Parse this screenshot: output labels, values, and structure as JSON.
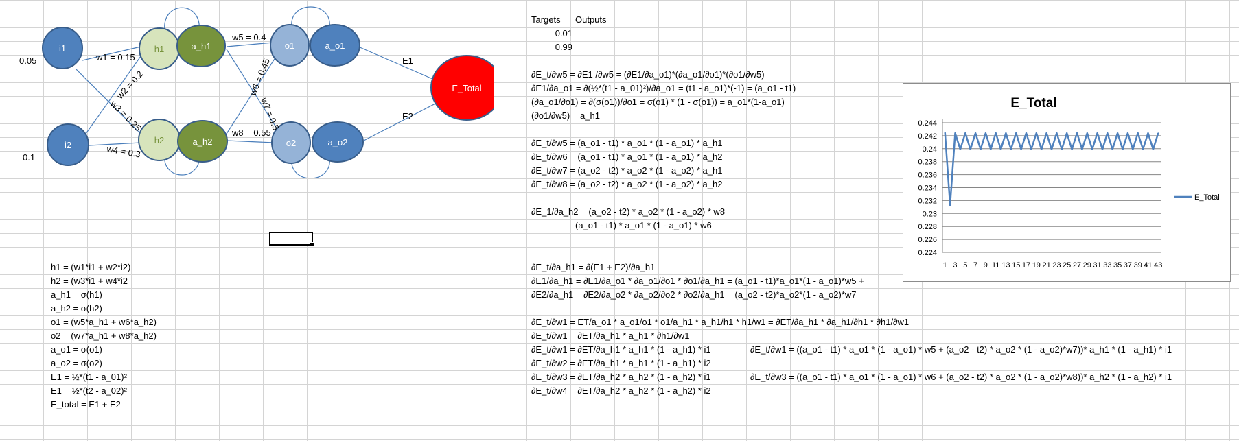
{
  "network": {
    "nodes": {
      "i1": "i1",
      "i2": "i2",
      "h1": "h1",
      "a_h1": "a_h1",
      "h2": "h2",
      "a_h2": "a_h2",
      "o1": "o1",
      "a_o1": "a_o1",
      "o2": "o2",
      "a_o2": "a_o2",
      "e_total": "E_Total"
    },
    "inputs": {
      "i1": "0.05",
      "i2": "0.1"
    },
    "weights": {
      "w1": "w1 = 0.15",
      "w2": "w2 = 0.2",
      "w3": "w3 = 0.25",
      "w4": "w4 = 0.3",
      "w5": "w5 = 0.4",
      "w6": "w6 = 0.45",
      "w7": "w7 = 0.5",
      "w8": "w8 = 0.55"
    },
    "errors": {
      "e1": "E1",
      "e2": "E2"
    },
    "colors": {
      "input_fill": "#4f81bd",
      "hidden_fill": "#d7e4bc",
      "hidden_text": "#77933c",
      "activation_fill": "#77933c",
      "output_fill": "#95b3d7",
      "output_act_fill": "#4f81bd",
      "total_fill": "#ff0000",
      "stroke": "#385d8a",
      "edge": "#4a7ebb"
    }
  },
  "targets": {
    "header_targets": "Targets",
    "header_outputs": "Outputs",
    "values": [
      "0.01",
      "0.99"
    ]
  },
  "forward_equations": [
    "h1 = (w1*i1 + w2*i2)",
    " h2 = (w3*i1 + w4*i2",
    "a_h1 = σ(h1)",
    "a_h2 = σ(h2)",
    "o1 = (w5*a_h1 + w6*a_h2)",
    "o2 = (w7*a_h1 + w8*a_h2)",
    "a_o1 = σ(o1)",
    "a_o2 = σ(o2)",
    "E1 = ½*(t1 - a_01)²",
    "E1 = ½*(t2 - a_02)²",
    "E_total = E1 + E2"
  ],
  "derivatives_w5": [
    "∂E_t/∂w5 = ∂E1 /∂w5 = (∂E1/∂a_o1)*(∂a_o1/∂o1)*(∂o1/∂w5)",
    "∂E1/∂a_o1 = ∂(½*(t1 - a_01)²)/∂a_o1 = (t1 - a_o1)*(-1) = (a_o1 - t1)",
    "(∂a_o1/∂o1) = ∂(σ(o1))/∂o1 = σ(o1) * (1 - σ(o1)) = a_o1*(1-a_o1)",
    "(∂o1/∂w5) = a_h1"
  ],
  "derivatives_w5_w8": [
    "∂E_t/∂w5 = (a_o1 - t1) * a_o1 * (1 - a_o1) * a_h1",
    "∂E_t/∂w6 = (a_o1 - t1) * a_o1 * (1 - a_o1) * a_h2",
    "∂E_t/∂w7 = (a_o2 - t2) * a_o2 * (1 - a_o2) * a_h1",
    "∂E_t/∂w8 = (a_o2 - t2) * a_o2 * (1 - a_o2) * a_h2"
  ],
  "derivative_a_h2": [
    "∂E_1/∂a_h2 = (a_o2 - t2) * a_o2 * (1 - a_o2) * w8",
    "(a_o1 - t1) * a_o1 * (1 - a_o1) * w6"
  ],
  "derivative_a_h1": [
    "∂E_t/∂a_h1 = ∂(E1 + E2)/∂a_h1",
    "∂E1/∂a_h1 = ∂E1/∂a_o1 * ∂a_o1/∂o1 * ∂o1/∂a_h1 = (a_o1 - t1)*a_o1*(1 - a_o1)*w5 +",
    "∂E2/∂a_h1 = ∂E2/∂a_o2 * ∂a_o2/∂o2 * ∂o2/∂a_h1 = (a_o2 - t2)*a_o2*(1 - a_o2)*w7"
  ],
  "derivatives_w1_w4": [
    "∂E_t/∂w1 = ET/a_o1 * a_o1/o1 * o1/a_h1 * a_h1/h1 * h1/w1 = ∂ET/∂a_h1 * ∂a_h1/∂h1 * ∂h1/∂w1",
    "∂E_t/∂w1 = ∂ET/∂a_h1 * a_h1 * ∂h1/∂w1",
    "∂E_t/∂w1 = ∂ET/∂a_h1 * a_h1 * (1 - a_h1) * i1",
    "∂E_t/∂w2 = ∂ET/∂a_h1 * a_h1 * (1 - a_h1) * i2",
    "∂E_t/∂w3 = ∂ET/∂a_h2 * a_h2 * (1 - a_h2) * i1",
    "∂E_t/∂w4 = ∂ET/∂a_h2 * a_h2 * (1 - a_h2) * i2"
  ],
  "expanded": {
    "w1": "∂E_t/∂w1 = ((a_o1 - t1) * a_o1 * (1 - a_o1) * w5 + (a_o2 - t2) * a_o2 * (1 - a_o2)*w7))* a_h1 * (1 - a_h1) * i1",
    "w3": "∂E_t/∂w3 = ((a_o1 - t1) * a_o1 * (1 - a_o1) * w6 + (a_o2 - t2) * a_o2 * (1 - a_o2)*w8))* a_h2 * (1 - a_h2) * i1"
  },
  "chart_data": {
    "type": "line",
    "title": "E_Total",
    "legend": "E_Total",
    "legend_position": "right",
    "series_color": "#4f81bd",
    "ylim": [
      0.224,
      0.244
    ],
    "y_ticks": [
      "0.224",
      "0.226",
      "0.228",
      "0.23",
      "0.232",
      "0.234",
      "0.236",
      "0.238",
      "0.24",
      "0.242",
      "0.244"
    ],
    "x_ticks": [
      "1",
      "3",
      "5",
      "7",
      "9",
      "11",
      "13",
      "15",
      "17",
      "19",
      "21",
      "23",
      "25",
      "27",
      "29",
      "31",
      "33",
      "35",
      "37",
      "39",
      "41",
      "43"
    ],
    "grid": true,
    "series": [
      {
        "name": "E_Total",
        "x": [
          1,
          2,
          3,
          4,
          5,
          6,
          7,
          8,
          9,
          10,
          11,
          12,
          13,
          14,
          15,
          16,
          17,
          18,
          19,
          20,
          21,
          22,
          23,
          24,
          25,
          26,
          27,
          28,
          29,
          30,
          31,
          32,
          33,
          34,
          35,
          36,
          37,
          38,
          39,
          40,
          41,
          42,
          43
        ],
        "values": [
          0.2425,
          0.2313,
          0.2424,
          0.2399,
          0.2424,
          0.2399,
          0.2424,
          0.2399,
          0.2424,
          0.2399,
          0.2424,
          0.2399,
          0.2424,
          0.2399,
          0.2424,
          0.2399,
          0.2424,
          0.2399,
          0.2424,
          0.2399,
          0.2424,
          0.2399,
          0.2424,
          0.2399,
          0.2424,
          0.2399,
          0.2424,
          0.2399,
          0.2424,
          0.2399,
          0.2424,
          0.2399,
          0.2424,
          0.2399,
          0.2424,
          0.2399,
          0.2424,
          0.2399,
          0.2424,
          0.2399,
          0.2424,
          0.2399,
          0.2424
        ]
      }
    ]
  }
}
